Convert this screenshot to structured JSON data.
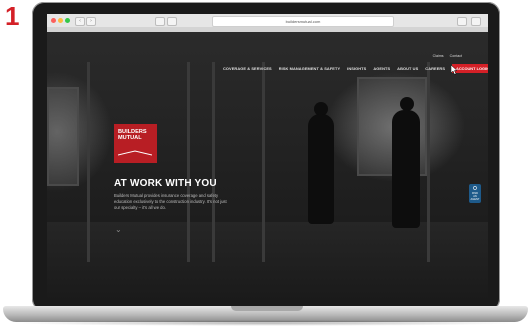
{
  "step": {
    "number": "1"
  },
  "browser": {
    "url": "buildersmutual.com"
  },
  "site": {
    "utility_nav": [
      "Claims",
      "Contact"
    ],
    "main_nav": [
      "COVERAGE & SERVICES",
      "RISK MANAGEMENT & SAFETY",
      "INSIGHTS",
      "AGENTS",
      "ABOUT US",
      "CAREERS"
    ],
    "account_login": "ACCOUNT LOGIN",
    "logo_line1": "BUILDERS",
    "logo_line2": "MUTUAL",
    "hero_heading": "AT WORK WITH YOU",
    "hero_body": "Builders Mutual provides insurance coverage and safety education exclusively to the construction industry. It's not just our specialty – it's all we do.",
    "side_tab_label": "FIND AN AGENT"
  },
  "colors": {
    "brand_red": "#d42027",
    "side_tab_blue": "#1e5a8a"
  }
}
